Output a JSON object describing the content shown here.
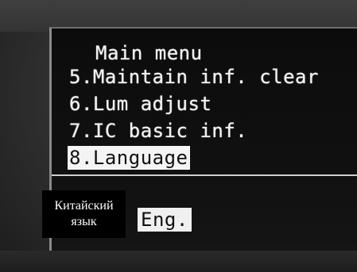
{
  "screen": {
    "title": "Main menu",
    "items": [
      {
        "label": "5.Maintain inf. clear"
      },
      {
        "label": "6.Lum adjust"
      },
      {
        "label": "7.IC basic inf."
      },
      {
        "label": "8.Language",
        "selected": true
      }
    ],
    "language_option": "Eng."
  },
  "annotation": {
    "line1": "Китайский",
    "line2": "язык"
  }
}
